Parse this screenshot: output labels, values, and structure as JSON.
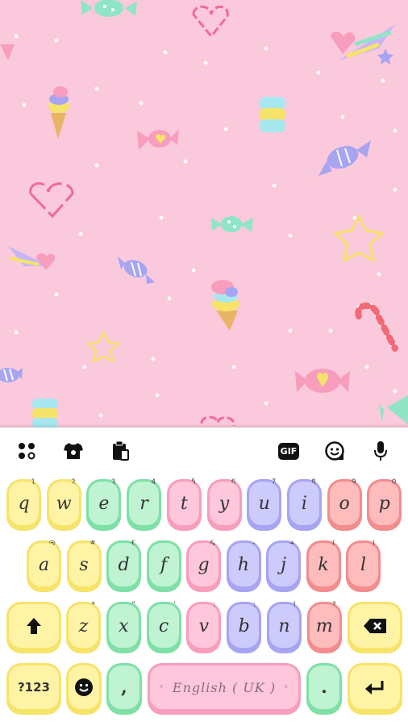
{
  "theme": {
    "name": "pastel-candy",
    "background": "#fbc9dc"
  },
  "toolbar": {
    "icons": [
      "apps-icon",
      "theme-shirt-icon",
      "clipboard-icon",
      "gif-icon",
      "emoji-sticker-icon",
      "microphone-icon"
    ],
    "gif_label": "GIF"
  },
  "keyboard": {
    "row1": [
      {
        "label": "q",
        "hint": "1",
        "color": "yellow"
      },
      {
        "label": "w",
        "hint": "2",
        "color": "yellow"
      },
      {
        "label": "e",
        "hint": "3",
        "color": "green"
      },
      {
        "label": "r",
        "hint": "4",
        "color": "green"
      },
      {
        "label": "t",
        "hint": "5",
        "color": "pink"
      },
      {
        "label": "y",
        "hint": "6",
        "color": "pink"
      },
      {
        "label": "u",
        "hint": "7",
        "color": "blue"
      },
      {
        "label": "i",
        "hint": "8",
        "color": "blue"
      },
      {
        "label": "o",
        "hint": "9",
        "color": "red"
      },
      {
        "label": "p",
        "hint": "0",
        "color": "red"
      }
    ],
    "row2": [
      {
        "label": "a",
        "hint": "@",
        "color": "yellow"
      },
      {
        "label": "s",
        "hint": "#",
        "color": "yellow"
      },
      {
        "label": "d",
        "hint": "£",
        "color": "green"
      },
      {
        "label": "f",
        "hint": "_",
        "color": "green"
      },
      {
        "label": "g",
        "hint": "&",
        "color": "pink"
      },
      {
        "label": "h",
        "hint": "-",
        "color": "blue"
      },
      {
        "label": "j",
        "hint": "+",
        "color": "blue"
      },
      {
        "label": "k",
        "hint": "(",
        "color": "red"
      },
      {
        "label": "l",
        "hint": ")",
        "color": "red"
      }
    ],
    "row3": [
      {
        "label": "z",
        "hint": "*",
        "color": "yellow"
      },
      {
        "label": "x",
        "hint": "\"",
        "color": "green"
      },
      {
        "label": "c",
        "hint": "'",
        "color": "green"
      },
      {
        "label": "v",
        "hint": ":",
        "color": "pink"
      },
      {
        "label": "b",
        "hint": ";",
        "color": "blue"
      },
      {
        "label": "n",
        "hint": "!",
        "color": "blue"
      },
      {
        "label": "m",
        "hint": "?",
        "color": "red"
      }
    ],
    "symbols_label": "?123",
    "comma_label": ",",
    "period_label": ".",
    "space_label": "English ( UK )",
    "space_arrow_left": "‹",
    "space_arrow_right": "›"
  }
}
